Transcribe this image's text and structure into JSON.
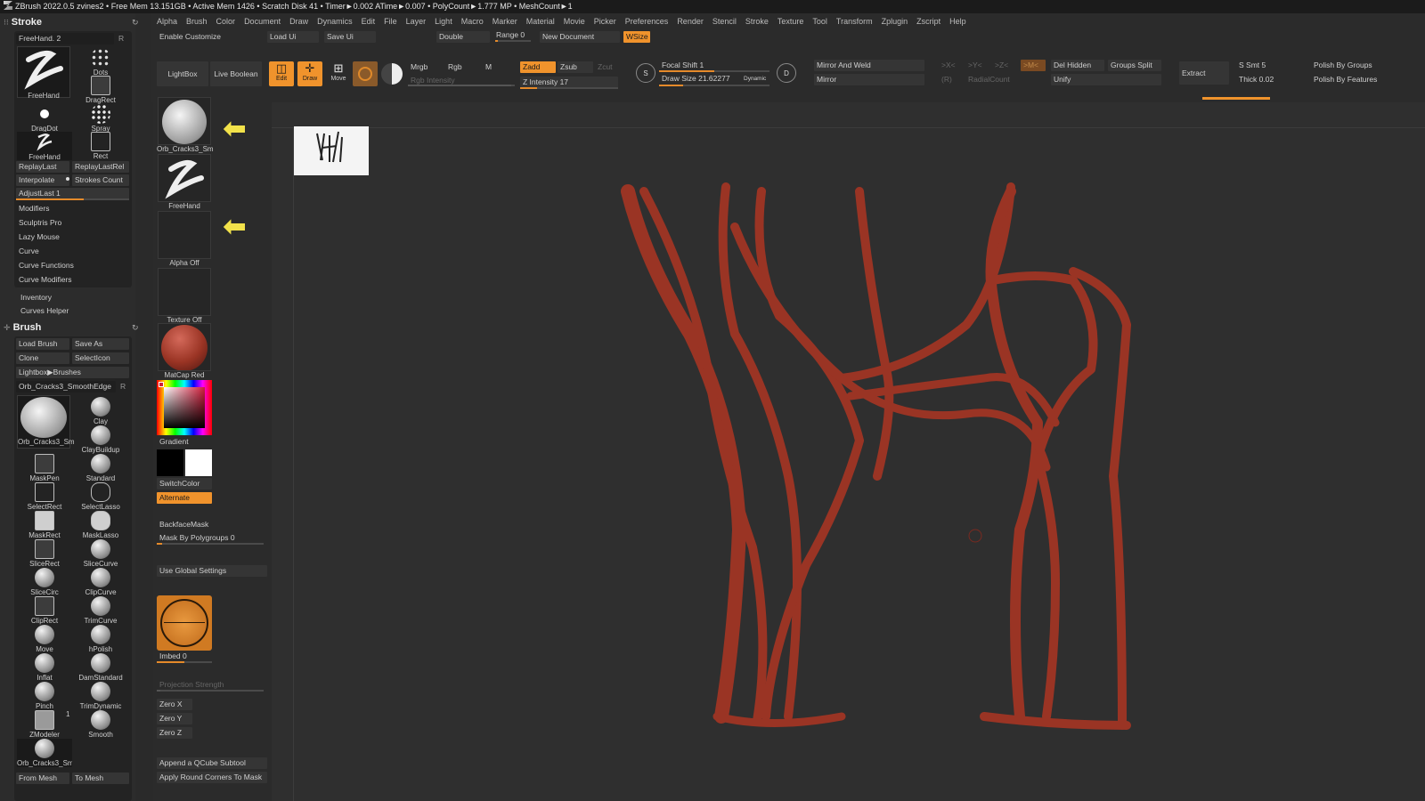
{
  "titlebar": {
    "text": "ZBrush 2022.0.5   zvines2   • Free Mem 13.151GB • Active Mem 1426 • Scratch Disk 41 •  Timer►0.002 ATime►0.007 • PolyCount►1.777 MP  • MeshCount►1"
  },
  "menu": [
    "Alpha",
    "Brush",
    "Color",
    "Document",
    "Draw",
    "Dynamics",
    "Edit",
    "File",
    "Layer",
    "Light",
    "Macro",
    "Marker",
    "Material",
    "Movie",
    "Picker",
    "Preferences",
    "Render",
    "Stencil",
    "Stroke",
    "Texture",
    "Tool",
    "Transform",
    "Zplugin",
    "Zscript",
    "Help"
  ],
  "stroke_panel": {
    "title": "Stroke",
    "stroke_select": "FreeHand. 2",
    "r_label": "R",
    "main_stroke": "FreeHand",
    "tools": [
      "Dots",
      "DragRect",
      "DragDot",
      "Spray",
      "FreeHand",
      "Rect"
    ],
    "replay_last": "ReplayLast",
    "replay_last_rel": "ReplayLastRel",
    "interpolate": "Interpolate",
    "strokes_count": "Strokes Count",
    "adjust_last": "AdjustLast 1",
    "sections": [
      "Modifiers",
      "Sculptris Pro",
      "Lazy Mouse",
      "Curve",
      "Curve Functions",
      "Curve Modifiers"
    ],
    "inventory": "Inventory",
    "curves_helper": "Curves Helper"
  },
  "brush_panel": {
    "title": "Brush",
    "load_brush": "Load Brush",
    "save_as": "Save As",
    "clone": "Clone",
    "select_icon": "SelectIcon",
    "lightbox_brushes": "Lightbox▶Brushes",
    "current_brush": "Orb_Cracks3_SmoothEdge",
    "r_label": "R",
    "current_brush_short": "Orb_Cracks3_Sm",
    "brushes": [
      "Clay",
      "ClayBuildup",
      "MaskPen",
      "Standard",
      "SelectRect",
      "SelectLasso",
      "MaskRect",
      "MaskLasso",
      "SliceRect",
      "SliceCurve",
      "SliceCirc",
      "ClipCurve",
      "ClipRect",
      "TrimCurve",
      "Move",
      "hPolish",
      "Inflat",
      "DamStandard",
      "Pinch",
      "TrimDynamic",
      "ZModeler",
      "Smooth"
    ],
    "zmodeler_badge": "1",
    "recent_brush": "Orb_Cracks3_Sm",
    "from_mesh": "From Mesh",
    "to_mesh": "To Mesh"
  },
  "shelf": {
    "enable_customize": "Enable Customize",
    "load_ui": "Load Ui",
    "save_ui": "Save Ui",
    "double": "Double",
    "range": "Range 0",
    "new_document": "New Document",
    "wsize": "WSize",
    "lightbox": "LightBox",
    "live_boolean": "Live Boolean",
    "edit": "Edit",
    "draw": "Draw",
    "move": "Move",
    "mrgb": "Mrgb",
    "rgb": "Rgb",
    "m": "M",
    "rgb_intensity": "Rgb Intensity",
    "zadd": "Zadd",
    "zsub": "Zsub",
    "zcut": "Zcut",
    "z_intensity": "Z Intensity 17",
    "focal_shift": "Focal Shift 1",
    "draw_size": "Draw Size 21.62277",
    "dynamic": "Dynamic",
    "s_label": "S",
    "d_label": "D",
    "mirror_and_weld": "Mirror And Weld",
    "mirror": "Mirror",
    "x_axis": ">X<",
    "y_axis": ">Y<",
    "z_axis": ">Z<",
    "m_axis": ">M<",
    "r_label": "(R)",
    "radial_count": "RadialCount",
    "del_hidden": "Del Hidden",
    "groups_split": "Groups Split",
    "unify": "Unify",
    "extract": "Extract",
    "s_smt": "S Smt 5",
    "thick": "Thick 0.02",
    "polish_by_groups": "Polish By Groups",
    "polish_by_features": "Polish By Features"
  },
  "mid_panel": {
    "brush_thumb": "Orb_Cracks3_Sm",
    "stroke_thumb": "FreeHand",
    "alpha": "Alpha Off",
    "texture": "Texture Off",
    "material": "MatCap Red Wax",
    "gradient": "Gradient",
    "switch_color": "SwitchColor",
    "alternate": "Alternate",
    "backface_mask": "BackfaceMask",
    "mask_by_polygroups": "Mask By Polygroups 0",
    "use_global_settings": "Use Global Settings",
    "imbed": "Imbed 0",
    "projection_strength": "Projection Strength",
    "zero_x": "Zero X",
    "zero_y": "Zero Y",
    "zero_z": "Zero Z",
    "append_qcube": "Append a QCube Subtool",
    "apply_round_corners": "Apply Round Corners To Mask"
  },
  "slider_levels": {
    "adjust_last": 0.6,
    "draw_size": 0.22,
    "focal_shift": 0.5,
    "z_intensity": 0.17,
    "imbed": 0.5
  },
  "colors": {
    "accent": "#f0932c",
    "vine_red": "#9a3424",
    "arrow_yellow": "#f2e24a"
  }
}
